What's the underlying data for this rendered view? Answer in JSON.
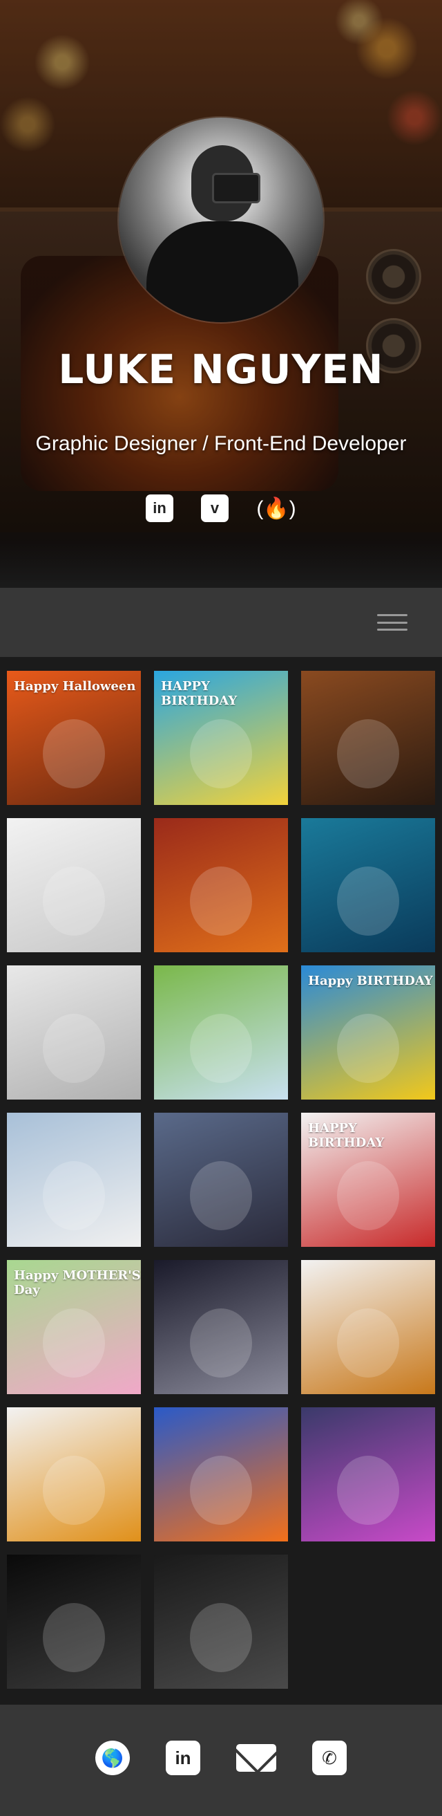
{
  "profile": {
    "name": "LUKE NGUYEN",
    "tagline": "Graphic Designer / Front-End Developer"
  },
  "socials": [
    {
      "name": "linkedin",
      "icon": "linkedin-icon",
      "glyph": "in"
    },
    {
      "name": "vimeo",
      "icon": "vimeo-icon",
      "glyph": "v"
    },
    {
      "name": "freecodecamp",
      "icon": "freecodecamp-icon",
      "glyph": "(🔥)"
    }
  ],
  "nav": {
    "menu_icon": "hamburger-menu-icon"
  },
  "gallery": {
    "items": [
      {
        "name": "happy-halloween-cat",
        "caption": "Happy Halloween",
        "colors": [
          "#e85a1a",
          "#6b2a10"
        ]
      },
      {
        "name": "happy-birthday-pug-pool",
        "caption": "HAPPY BIRTHDAY",
        "colors": [
          "#2aa6e0",
          "#f2d23a"
        ]
      },
      {
        "name": "pug-tv-fireplace",
        "caption": "",
        "colors": [
          "#8a4a20",
          "#2a1a10"
        ]
      },
      {
        "name": "dalmatian-sewing-machine",
        "caption": "",
        "colors": [
          "#f2f2f2",
          "#c8c8c8"
        ]
      },
      {
        "name": "cat-on-fireplace",
        "caption": "",
        "colors": [
          "#9a2a1a",
          "#e0701a"
        ]
      },
      {
        "name": "cat-snorkel-underwater",
        "caption": "",
        "colors": [
          "#1a7a9a",
          "#0a3a5a"
        ]
      },
      {
        "name": "pug-party-hat",
        "caption": "",
        "colors": [
          "#e8e8e8",
          "#b0b0b0"
        ]
      },
      {
        "name": "teddy-bear-picnic",
        "caption": "",
        "colors": [
          "#7ab84a",
          "#c8e0f0"
        ]
      },
      {
        "name": "happy-birthday-dog-plane",
        "caption": "Happy BIRTHDAY",
        "colors": [
          "#2a8ad8",
          "#f2c81a"
        ]
      },
      {
        "name": "meerkats-snow",
        "caption": "",
        "colors": [
          "#a8c0d8",
          "#f0f0f0"
        ]
      },
      {
        "name": "cat-birthday-cake",
        "caption": "",
        "colors": [
          "#5a6a8a",
          "#2a2a3a"
        ]
      },
      {
        "name": "happy-birthday-chimp",
        "caption": "HAPPY BIRTHDAY",
        "colors": [
          "#f2f2f2",
          "#c82a2a"
        ]
      },
      {
        "name": "happy-mothers-day-bear",
        "caption": "Happy MOTHER'S Day",
        "colors": [
          "#a8d890",
          "#f0a8c8"
        ]
      },
      {
        "name": "cat-rocket-moon",
        "caption": "",
        "colors": [
          "#1a1a2a",
          "#8a8a9a"
        ]
      },
      {
        "name": "low-poly-eagle",
        "caption": "",
        "colors": [
          "#f2f2f2",
          "#c8781a"
        ]
      },
      {
        "name": "low-poly-lion",
        "caption": "",
        "colors": [
          "#f2f2f2",
          "#e0901a"
        ]
      },
      {
        "name": "orange-game-controller",
        "caption": "",
        "colors": [
          "#2a5ac8",
          "#f2701a"
        ]
      },
      {
        "name": "dancer-light-trails",
        "caption": "",
        "colors": [
          "#3a3a6a",
          "#c84ac8"
        ]
      },
      {
        "name": "dancer-black-white-1",
        "caption": "",
        "colors": [
          "#0a0a0a",
          "#3a3a3a"
        ]
      },
      {
        "name": "dancer-black-white-2",
        "caption": "",
        "colors": [
          "#1a1a1a",
          "#4a4a4a"
        ]
      }
    ]
  },
  "footer": {
    "icons": [
      {
        "name": "website",
        "icon": "globe-icon",
        "glyph": "🌎"
      },
      {
        "name": "linkedin",
        "icon": "linkedin-icon",
        "glyph": "in"
      },
      {
        "name": "email",
        "icon": "mail-icon",
        "glyph": ""
      },
      {
        "name": "phone",
        "icon": "phone-icon",
        "glyph": "✆"
      }
    ]
  }
}
